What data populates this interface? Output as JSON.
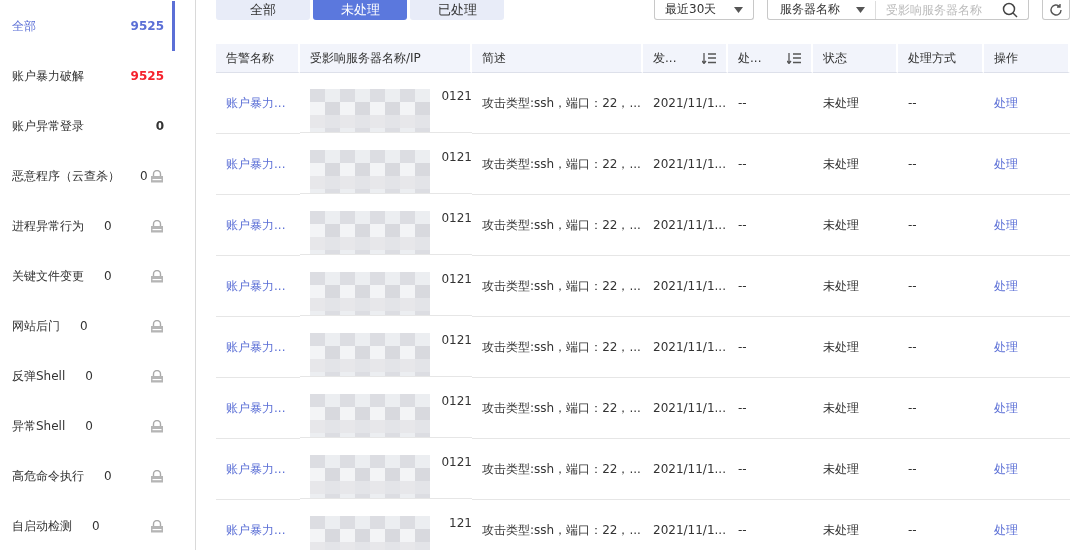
{
  "sidebar": {
    "items": [
      {
        "label": "全部",
        "count": "9525",
        "selected": true,
        "locked": false,
        "color": "#5b6fd6"
      },
      {
        "label": "账户暴力破解",
        "count": "9525",
        "selected": false,
        "locked": false,
        "color": "#f5222d"
      },
      {
        "label": "账户异常登录",
        "count": "0",
        "selected": false,
        "locked": false,
        "color": "#333333"
      },
      {
        "label": "恶意程序（云查杀）",
        "count": "0",
        "selected": false,
        "locked": true,
        "color": "#333333"
      },
      {
        "label": "进程异常行为",
        "count": "0",
        "selected": false,
        "locked": true,
        "color": "#333333"
      },
      {
        "label": "关键文件变更",
        "count": "0",
        "selected": false,
        "locked": true,
        "color": "#333333"
      },
      {
        "label": "网站后门",
        "count": "0",
        "selected": false,
        "locked": true,
        "color": "#333333"
      },
      {
        "label": "反弹Shell",
        "count": "0",
        "selected": false,
        "locked": true,
        "color": "#333333"
      },
      {
        "label": "异常Shell",
        "count": "0",
        "selected": false,
        "locked": true,
        "color": "#333333"
      },
      {
        "label": "高危命令执行",
        "count": "0",
        "selected": false,
        "locked": true,
        "color": "#333333"
      },
      {
        "label": "自启动检测",
        "count": "0",
        "selected": false,
        "locked": true,
        "color": "#333333"
      }
    ]
  },
  "tabs": [
    {
      "label": "全部",
      "selected": false
    },
    {
      "label": "未处理",
      "selected": true
    },
    {
      "label": "已处理",
      "selected": false
    }
  ],
  "period_select": {
    "value": "最近30天"
  },
  "search": {
    "field_select": "服务器名称",
    "placeholder": "受影响服务器名称"
  },
  "table": {
    "columns": [
      {
        "label": "告警名称",
        "sortable": false
      },
      {
        "label": "受影响服务器名称/IP",
        "sortable": false
      },
      {
        "label": "简述",
        "sortable": false
      },
      {
        "label": "发...",
        "sortable": true
      },
      {
        "label": "处...",
        "sortable": true
      },
      {
        "label": "状态",
        "sortable": false
      },
      {
        "label": "处理方式",
        "sortable": false
      },
      {
        "label": "操作",
        "sortable": false
      }
    ],
    "rows": [
      {
        "alarm": "账户暴力...",
        "server": "0121",
        "summary": "攻击类型:ssh，端口：22，...",
        "time": "2021/11/1...",
        "handled_at": "--",
        "status": "未处理",
        "method": "--",
        "action": "处理"
      },
      {
        "alarm": "账户暴力...",
        "server": "0121",
        "summary": "攻击类型:ssh，端口：22，...",
        "time": "2021/11/1...",
        "handled_at": "--",
        "status": "未处理",
        "method": "--",
        "action": "处理"
      },
      {
        "alarm": "账户暴力...",
        "server": "0121",
        "summary": "攻击类型:ssh，端口：22，...",
        "time": "2021/11/1...",
        "handled_at": "--",
        "status": "未处理",
        "method": "--",
        "action": "处理"
      },
      {
        "alarm": "账户暴力...",
        "server": "0121",
        "summary": "攻击类型:ssh，端口：22，...",
        "time": "2021/11/1...",
        "handled_at": "--",
        "status": "未处理",
        "method": "--",
        "action": "处理"
      },
      {
        "alarm": "账户暴力...",
        "server": "0121",
        "summary": "攻击类型:ssh，端口：22，...",
        "time": "2021/11/1...",
        "handled_at": "--",
        "status": "未处理",
        "method": "--",
        "action": "处理"
      },
      {
        "alarm": "账户暴力...",
        "server": "0121",
        "summary": "攻击类型:ssh，端口：22，...",
        "time": "2021/11/1...",
        "handled_at": "--",
        "status": "未处理",
        "method": "--",
        "action": "处理"
      },
      {
        "alarm": "账户暴力...",
        "server": "0121",
        "summary": "攻击类型:ssh，端口：22，...",
        "time": "2021/11/1...",
        "handled_at": "--",
        "status": "未处理",
        "method": "--",
        "action": "处理"
      },
      {
        "alarm": "账户暴力...",
        "server": "121",
        "summary": "攻击类型:ssh，端口：22，...",
        "time": "2021/11/1...",
        "handled_at": "--",
        "status": "未处理",
        "method": "--",
        "action": "处理"
      }
    ]
  }
}
